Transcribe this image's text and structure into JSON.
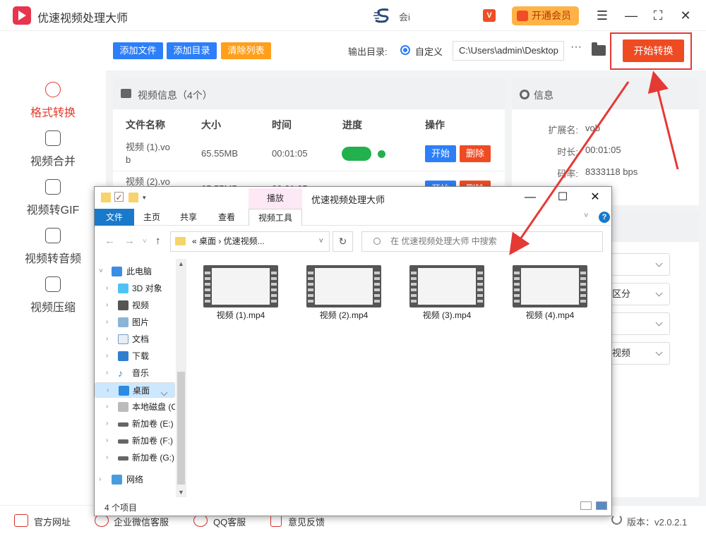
{
  "app": {
    "title": "优速视频处理大师",
    "user": "会i",
    "vip_badge": "V",
    "vip_button": "开通会员"
  },
  "window_controls": {
    "menu": "☰",
    "minimize": "—",
    "maximize": "⛶",
    "close": "✕"
  },
  "sidebar": {
    "items": [
      {
        "label": "格式转换",
        "icon": "convert-icon",
        "active": true
      },
      {
        "label": "视频合并",
        "icon": "merge-icon"
      },
      {
        "label": "视频转GIF",
        "icon": "gif-icon"
      },
      {
        "label": "视频转音频",
        "icon": "audio-icon"
      },
      {
        "label": "视频压缩",
        "icon": "compress-icon"
      }
    ]
  },
  "toolbar": {
    "add_file": "添加文件",
    "add_dir": "添加目录",
    "clear_list": "清除列表",
    "output_label": "输出目录:",
    "custom_label": "自定义",
    "output_path": "C:\\Users\\admin\\Desktop",
    "more": "···",
    "start": "开始转换",
    "colors": {
      "blue": "#2d7ff9",
      "orange": "#ff9f1c",
      "red": "#ef4b23"
    }
  },
  "video_panel": {
    "title": "视频信息（4个）",
    "columns": [
      "文件名称",
      "大小",
      "时间",
      "进度",
      "操作"
    ],
    "rows": [
      {
        "name": "视频 (1).vo\nb",
        "size": "65.55MB",
        "time": "00:01:05",
        "start": "开始",
        "delete": "删除"
      },
      {
        "name": "视频 (2).vo",
        "size": "65.55MB",
        "time": "00:01:05",
        "start": "开始",
        "delete": "删除"
      }
    ]
  },
  "info_panel": {
    "title": "信息",
    "fields": [
      {
        "label": "扩展名:",
        "value": "vob"
      },
      {
        "label": "时长:",
        "value": "00:01:05"
      },
      {
        "label": "码率:",
        "value": "8333118 bps"
      }
    ]
  },
  "settings_partial": {
    "sel2": "区分",
    "sel4": "视频"
  },
  "footer": {
    "links": [
      "官方网址",
      "企业微信客服",
      "QQ客服",
      "意见反馈"
    ],
    "version": "版本：v2.0.2.1"
  },
  "explorer": {
    "context_tab": "播放",
    "window_title": "优速视频处理大师",
    "ribbon_tabs": [
      "文件",
      "主页",
      "共享",
      "查看",
      "视频工具"
    ],
    "help": "?",
    "address": "«  桌面  ›  优速视频...",
    "search_placeholder": "在 优速视频处理大师 中搜索",
    "tree": [
      {
        "label": "此电脑",
        "level": 0,
        "icon": "computer-icon",
        "expanded": true
      },
      {
        "label": "3D 对象",
        "level": 1,
        "icon": "3d-objects-icon"
      },
      {
        "label": "视频",
        "level": 1,
        "icon": "videos-icon"
      },
      {
        "label": "图片",
        "level": 1,
        "icon": "pictures-icon"
      },
      {
        "label": "文档",
        "level": 1,
        "icon": "documents-icon"
      },
      {
        "label": "下载",
        "level": 1,
        "icon": "downloads-icon"
      },
      {
        "label": "音乐",
        "level": 1,
        "icon": "music-icon"
      },
      {
        "label": "桌面",
        "level": 1,
        "icon": "desktop-icon",
        "selected": true
      },
      {
        "label": "本地磁盘 (C",
        "level": 1,
        "icon": "drive-icon"
      },
      {
        "label": "新加卷 (E:)",
        "level": 1,
        "icon": "drive-icon"
      },
      {
        "label": "新加卷 (F:)",
        "level": 1,
        "icon": "drive-icon"
      },
      {
        "label": "新加卷 (G:)",
        "level": 1,
        "icon": "drive-icon"
      },
      {
        "label": "网络",
        "level": 0,
        "icon": "network-icon"
      }
    ],
    "files": [
      "视频 (1).mp4",
      "视频 (2).mp4",
      "视频 (3).mp4",
      "视频 (4).mp4"
    ],
    "status": "4 个项目"
  }
}
